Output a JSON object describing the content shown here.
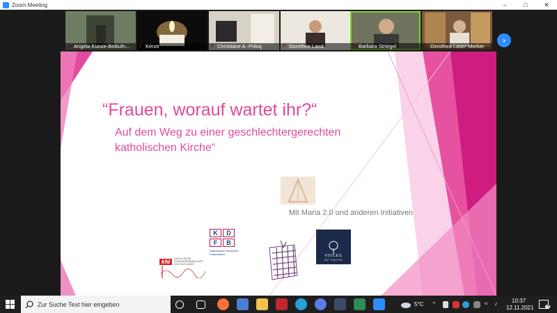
{
  "window": {
    "title": "Zoom Meeting"
  },
  "participants": [
    {
      "name": "Angela Kunze-Beikufn...",
      "bg": "#4b5a4a"
    },
    {
      "name": "Kerze",
      "bg": "#111111"
    },
    {
      "name": "Christiane A.-Pokoj",
      "bg": "#c9c2b6"
    },
    {
      "name": "Dorothee Land",
      "bg": "#e8e4dc"
    },
    {
      "name": "Barbara Striegel",
      "bg": "#7a7d6e"
    },
    {
      "name": "Dorothea Laser-Merker",
      "bg": "#8a6a4a"
    }
  ],
  "active_speaker": "Barbara Striegel",
  "slide": {
    "title": "“Frauen, worauf wartet ihr?“",
    "subtitle_line1": "Auf dem Weg zu einer geschlechtergerechten",
    "subtitle_line2": "katholischen Kirche“",
    "footer_text": "Mit Maria 2.0 und anderen Initiativen",
    "logos": {
      "kdfb_letters": [
        "K",
        "D",
        "F",
        "B"
      ],
      "kdfb_caption": "Katholischer Deutscher Frauenbund",
      "kfd_label": "kfd",
      "kfd_caption": "KATHOLISCHE FRAUENGEMEINSCHAFT DEUTSCHLANDS",
      "vof_line1": "VOICES",
      "vof_line2": "OF FAITH"
    },
    "accent_color": "#e0499a"
  },
  "taskbar": {
    "search_placeholder": "Zur Suche Text hier eingeben",
    "weather": "5°C",
    "time": "10:37",
    "date": "12.11.2021",
    "notification_count": "3"
  }
}
